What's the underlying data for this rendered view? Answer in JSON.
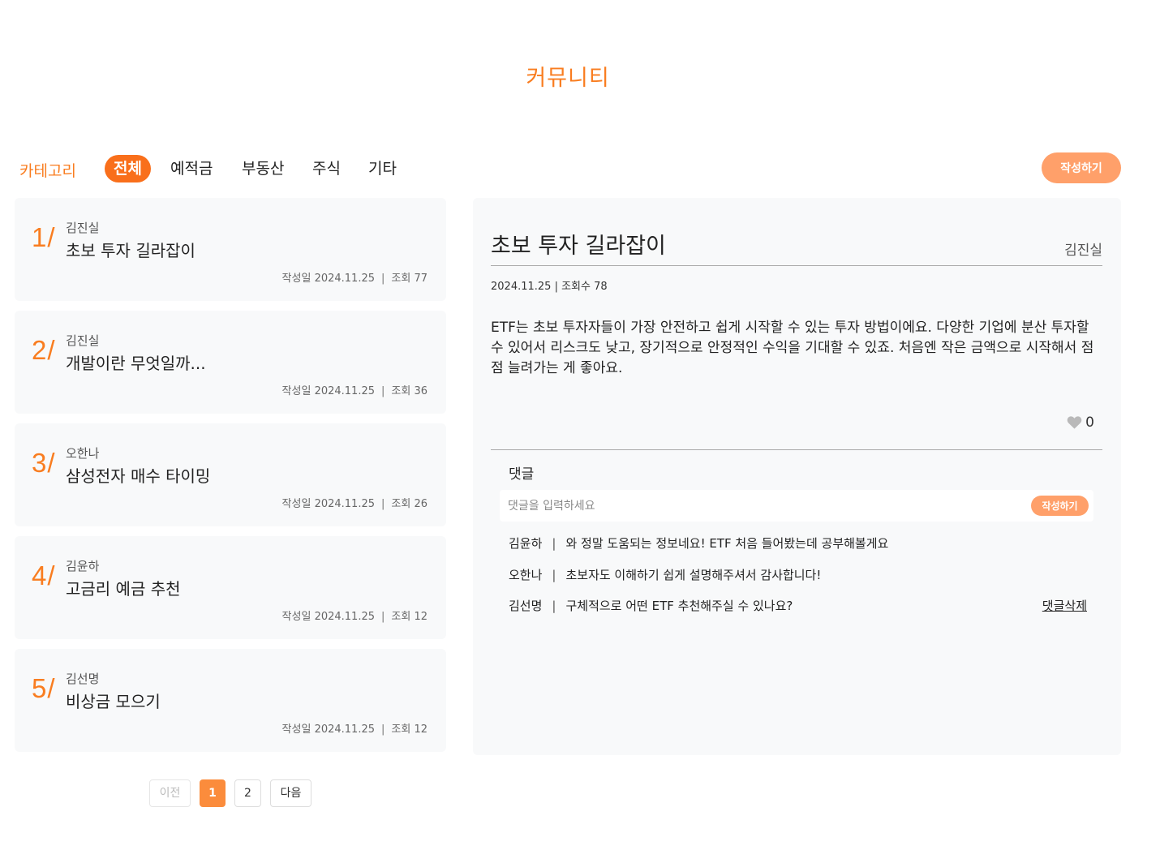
{
  "page": {
    "title": "커뮤니티"
  },
  "category": {
    "label": "카테고리",
    "tabs": [
      "전체",
      "예적금",
      "부동산",
      "주식",
      "기타"
    ],
    "active": "전체",
    "write_label": "작성하기"
  },
  "posts": [
    {
      "num": "1/",
      "author": "김진실",
      "title": "초보 투자 길라잡이",
      "date_label": "작성일",
      "date": "2024.11.25",
      "views_label": "조회",
      "views": "77"
    },
    {
      "num": "2/",
      "author": "김진실",
      "title": "개발이란 무엇일까...",
      "date_label": "작성일",
      "date": "2024.11.25",
      "views_label": "조회",
      "views": "36"
    },
    {
      "num": "3/",
      "author": "오한나",
      "title": "삼성전자 매수 타이밍",
      "date_label": "작성일",
      "date": "2024.11.25",
      "views_label": "조회",
      "views": "26"
    },
    {
      "num": "4/",
      "author": "김윤하",
      "title": "고금리 예금 추천",
      "date_label": "작성일",
      "date": "2024.11.25",
      "views_label": "조회",
      "views": "12"
    },
    {
      "num": "5/",
      "author": "김선명",
      "title": "비상금 모으기",
      "date_label": "작성일",
      "date": "2024.11.25",
      "views_label": "조회",
      "views": "12"
    }
  ],
  "pagination": {
    "prev": "이전",
    "pages": [
      "1",
      "2"
    ],
    "current": "1",
    "next": "다음"
  },
  "detail": {
    "title": "초보 투자 길라잡이",
    "author": "김진실",
    "meta": "2024.11.25 | 조회수 78",
    "body": "ETF는 초보 투자자들이 가장 안전하고 쉽게 시작할 수 있는 투자 방법이에요. 다양한 기업에 분산 투자할 수 있어서 리스크도 낮고, 장기적으로 안정적인 수익을 기대할 수 있죠. 처음엔 작은 금액으로 시작해서 점점 늘려가는 게 좋아요.",
    "likes": "0",
    "like_icon": "heart-icon"
  },
  "comments": {
    "header": "댓글",
    "placeholder": "댓글을 입력하세요",
    "submit_label": "작성하기",
    "delete_label": "댓글삭제",
    "items": [
      {
        "author": "김윤하",
        "text": "와 정말 도움되는 정보네요! ETF 처음 들어봤는데 공부해볼게요"
      },
      {
        "author": "오한나",
        "text": "초보자도 이해하기 쉽게 설명해주셔서 감사합니다!"
      },
      {
        "author": "김선명",
        "text": "구체적으로 어떤 ETF 추천해주실 수 있나요?"
      }
    ]
  },
  "colors": {
    "accent": "#f97d20",
    "active_tab": "#f96f1b",
    "button": "#ffa06a",
    "card_bg": "#f8f9fa"
  }
}
